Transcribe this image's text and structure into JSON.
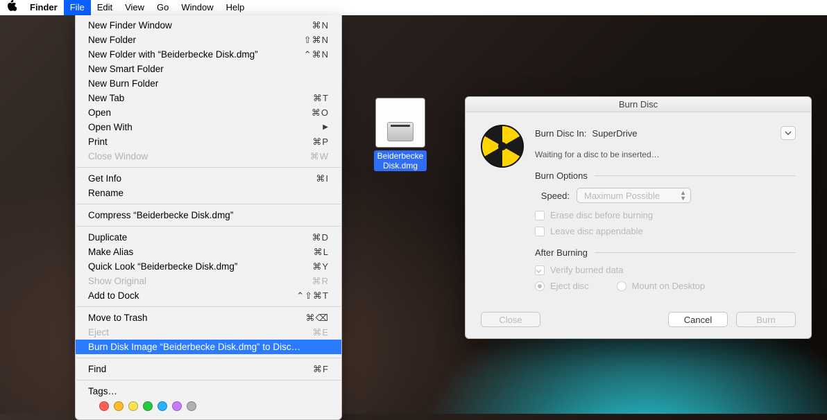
{
  "menubar": {
    "app": "Finder",
    "items": [
      "File",
      "Edit",
      "View",
      "Go",
      "Window",
      "Help"
    ],
    "active_index": 0
  },
  "file_menu": {
    "groups": [
      [
        {
          "label": "New Finder Window",
          "shortcut": "⌘N"
        },
        {
          "label": "New Folder",
          "shortcut": "⇧⌘N"
        },
        {
          "label": "New Folder with “Beiderbecke Disk.dmg”",
          "shortcut": "⌃⌘N"
        },
        {
          "label": "New Smart Folder",
          "shortcut": ""
        },
        {
          "label": "New Burn Folder",
          "shortcut": ""
        },
        {
          "label": "New Tab",
          "shortcut": "⌘T"
        },
        {
          "label": "Open",
          "shortcut": "⌘O"
        },
        {
          "label": "Open With",
          "shortcut": "▶",
          "submenu": true
        },
        {
          "label": "Print",
          "shortcut": "⌘P"
        },
        {
          "label": "Close Window",
          "shortcut": "⌘W",
          "disabled": true
        }
      ],
      [
        {
          "label": "Get Info",
          "shortcut": "⌘I"
        },
        {
          "label": "Rename",
          "shortcut": ""
        }
      ],
      [
        {
          "label": "Compress “Beiderbecke Disk.dmg”",
          "shortcut": ""
        }
      ],
      [
        {
          "label": "Duplicate",
          "shortcut": "⌘D"
        },
        {
          "label": "Make Alias",
          "shortcut": "⌘L"
        },
        {
          "label": "Quick Look “Beiderbecke Disk.dmg”",
          "shortcut": "⌘Y"
        },
        {
          "label": "Show Original",
          "shortcut": "⌘R",
          "disabled": true
        },
        {
          "label": "Add to Dock",
          "shortcut": "⌃⇧⌘T"
        }
      ],
      [
        {
          "label": "Move to Trash",
          "shortcut": "⌘⌫"
        },
        {
          "label": "Eject",
          "shortcut": "⌘E",
          "disabled": true
        },
        {
          "label": "Burn Disk Image “Beiderbecke Disk.dmg” to Disc…",
          "shortcut": "",
          "highlight": true
        }
      ],
      [
        {
          "label": "Find",
          "shortcut": "⌘F"
        }
      ],
      [
        {
          "label": "Tags…",
          "shortcut": ""
        }
      ]
    ],
    "tag_colors": [
      "#ff5f56",
      "#ffbd2e",
      "#ffe24f",
      "#27c940",
      "#29b1ff",
      "#c97bff",
      "#b0b0b0"
    ]
  },
  "desktop": {
    "file_name": "Beiderbecke Disk.dmg"
  },
  "dialog": {
    "title": "Burn Disc",
    "drive_label": "Burn Disc In:",
    "drive_value": "SuperDrive",
    "status": "Waiting for a disc to be inserted…",
    "options_header": "Burn Options",
    "speed_label": "Speed:",
    "speed_value": "Maximum Possible",
    "erase_label": "Erase disc before burning",
    "appendable_label": "Leave disc appendable",
    "after_header": "After Burning",
    "verify_label": "Verify burned data",
    "eject_label": "Eject disc",
    "mount_label": "Mount on Desktop",
    "btn_close": "Close",
    "btn_cancel": "Cancel",
    "btn_burn": "Burn"
  }
}
